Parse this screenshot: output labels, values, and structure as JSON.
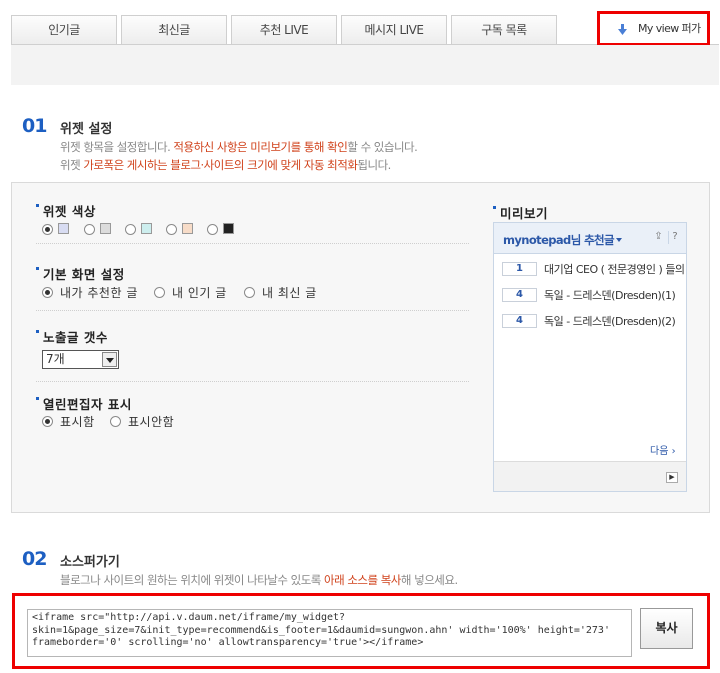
{
  "tabs": [
    "인기글",
    "최신글",
    "추천 LIVE",
    "메시지 LIVE",
    "구독 목록"
  ],
  "myview_label": "My view 퍼가기",
  "section1": {
    "num": "01",
    "title": "위젯 설정",
    "line1": {
      "a": "위젯 항목을 설정합니다. ",
      "b": "적용하신 사항은 미리보기를 통해 확인",
      "c": "할 수 있습니다."
    },
    "line2": {
      "a": "위젯 ",
      "b": "가로폭은 게시하는 블로그·사이트의 크기에 맞게 자동 최적화",
      "c": "됩니다."
    }
  },
  "widget_color": {
    "label": "위젯 색상",
    "swatches": [
      "#d8dcf2",
      "#dcdcdc",
      "#cdeeee",
      "#f7dcc8",
      "#222222"
    ],
    "selected": 0
  },
  "default_view": {
    "label": "기본 화면 설정",
    "options": [
      "내가 추천한 글",
      "내 인기 글",
      "내 최신 글"
    ],
    "selected": 0
  },
  "post_count": {
    "label": "노출글 갯수",
    "value": "7개"
  },
  "editor_display": {
    "label": "열린편집자 표시",
    "options": [
      "표시함",
      "표시안함"
    ],
    "selected": 0
  },
  "preview": {
    "label": "미리보기",
    "title": "mynotepad님 추천글",
    "items": [
      {
        "rank": "1",
        "text": "대기업 CEO ( 전문경영인 ) 들의"
      },
      {
        "rank": "4",
        "text": "독일 - 드레스덴(Dresden)(1)"
      },
      {
        "rank": "4",
        "text": "독일 - 드레스덴(Dresden)(2)"
      }
    ],
    "next": "다음"
  },
  "section2": {
    "num": "02",
    "title": "소스퍼가기",
    "desc": {
      "a": "블로그나 사이트의 원하는 위치에 위젯이 나타날수 있도록 ",
      "b": "아래 소스를 복사",
      "c": "해 넣으세요."
    }
  },
  "source_code": "<iframe src=\"http://api.v.daum.net/iframe/my_widget?\nskin=1&page_size=7&init_type=recommend&is_footer=1&daumid=sungwon.ahn' width='100%' height='273'\nframeborder='0' scrolling='no' allowtransparency='true'></iframe>",
  "copy_button": "복사"
}
